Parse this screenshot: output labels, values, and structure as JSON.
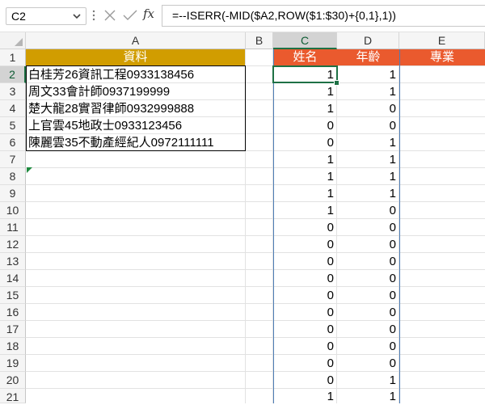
{
  "formula_bar": {
    "name_box": "C2",
    "fx_label": "fx",
    "formula": "=--ISERR(-MID($A2,ROW($1:$30)+{0,1},1))"
  },
  "columns": [
    "A",
    "B",
    "C",
    "D",
    "E"
  ],
  "rows": [
    "1",
    "2",
    "3",
    "4",
    "5",
    "6",
    "7",
    "8",
    "9",
    "10",
    "11",
    "12",
    "13",
    "14",
    "15",
    "16",
    "17",
    "18",
    "19",
    "20",
    "21"
  ],
  "headers": {
    "A1": "資料",
    "C1": "姓名",
    "D1": "年齡",
    "E1": "專業"
  },
  "column_a_data": [
    "白桂芳26資訊工程0933138456",
    "周文33會計師0937199999",
    "楚大龍28實習律師0932999888",
    "上官雲45地政士0933123456",
    "陳麗雲35不動產經紀人0972111111"
  ],
  "column_c_values": [
    "1",
    "1",
    "1",
    "0",
    "0",
    "1",
    "1",
    "1",
    "1",
    "0",
    "0",
    "0",
    "0",
    "0",
    "0",
    "0",
    "0",
    "0",
    "0",
    "1"
  ],
  "column_d_values": [
    "1",
    "1",
    "0",
    "0",
    "1",
    "1",
    "1",
    "1",
    "0",
    "0",
    "0",
    "0",
    "0",
    "0",
    "0",
    "0",
    "0",
    "0",
    "1",
    "1"
  ],
  "colors": {
    "header_a": "#d19d00",
    "header_cde": "#ea5a2e",
    "selection": "#1e7145"
  }
}
